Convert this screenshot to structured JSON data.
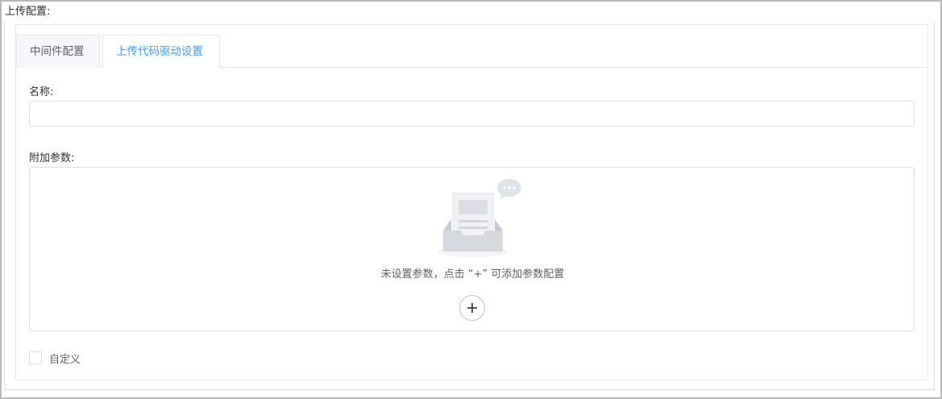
{
  "section": {
    "title": "上传配置:"
  },
  "tabs": [
    {
      "label": "中间件配置",
      "active": false
    },
    {
      "label": "上传代码驱动设置",
      "active": true
    }
  ],
  "form": {
    "name_label": "名称:",
    "name_value": "",
    "params_label": "附加参数:",
    "empty_text": "未设置参数，点击 “+” 可添加参数配置",
    "add_icon": "plus-icon",
    "custom_label": "自定义",
    "custom_checked": false
  },
  "colors": {
    "accent": "#409eff",
    "border": "#dcdfe6",
    "text": "#303133",
    "muted": "#606266"
  }
}
